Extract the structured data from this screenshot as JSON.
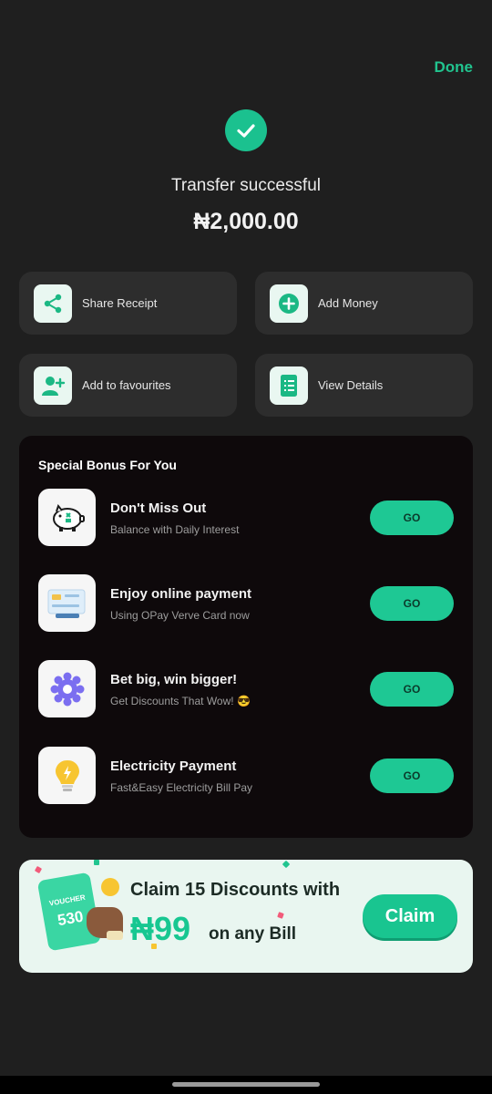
{
  "header": {
    "done_label": "Done"
  },
  "status": {
    "title": "Transfer successful",
    "amount": "₦2,000.00"
  },
  "actions": [
    {
      "label": "Share Receipt",
      "icon": "share-icon"
    },
    {
      "label": "Add Money",
      "icon": "plus-circle-icon"
    },
    {
      "label": "Add to favourites",
      "icon": "add-user-icon"
    },
    {
      "label": "View Details",
      "icon": "document-icon"
    }
  ],
  "bonus": {
    "title": "Special Bonus For You",
    "items": [
      {
        "title": "Don't Miss Out",
        "subtitle": "Balance with Daily Interest",
        "button": "GO",
        "icon": "piggy-bank-icon"
      },
      {
        "title": "Enjoy online payment",
        "subtitle": "Using OPay Verve Card now",
        "button": "GO",
        "icon": "card-icon"
      },
      {
        "title": "Bet big, win bigger!",
        "subtitle": "Get Discounts That Wow! 😎",
        "button": "GO",
        "icon": "gear-ball-icon"
      },
      {
        "title": "Electricity Payment",
        "subtitle": "Fast&Easy Electricity Bill Pay",
        "button": "GO",
        "icon": "lightbulb-icon"
      }
    ]
  },
  "promo": {
    "line1": "Claim 15 Discounts with",
    "price": "₦99",
    "line2": "on any Bill",
    "button": "Claim",
    "voucher_label": "VOUCHER",
    "voucher_number": "530"
  },
  "colors": {
    "accent": "#1ec894",
    "background": "#1f1f1f",
    "card": "#2d2d2d",
    "bonus_panel": "#0e090b"
  }
}
